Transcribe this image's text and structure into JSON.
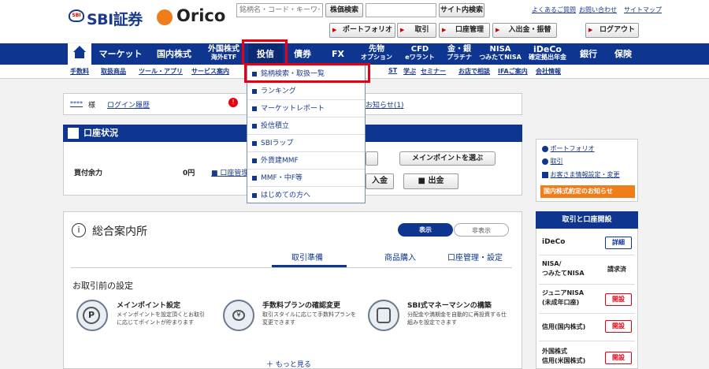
{
  "header": {
    "sbi_logo_text": "SBI証券",
    "sbi_mark_text": "SBI",
    "orico_logo_text": "Orico",
    "search_placeholder": "銘柄名・コード・キーワード",
    "stock_search_button": "株価検索",
    "site_search_button": "サイト内検索",
    "top_links": [
      "よくあるご質問",
      "お問い合わせ",
      "サイトマップ"
    ],
    "nav_buttons": [
      "ポートフォリオ",
      "取引",
      "口座管理",
      "入出金・振替"
    ],
    "logout_button": "ログアウト"
  },
  "main_nav": {
    "items": [
      {
        "label": "マーケット"
      },
      {
        "label": "国内株式"
      },
      {
        "label": "外国株式",
        "sub": "海外ETF"
      },
      {
        "label": "投信"
      },
      {
        "label": "債券"
      },
      {
        "label": "FX"
      },
      {
        "label": "先物",
        "sub": "オプション"
      },
      {
        "label": "CFD",
        "sub": "eワラント"
      },
      {
        "label": "金・銀",
        "sub": "プラチナ"
      },
      {
        "label": "NISA",
        "sub": "つみたてNISA"
      },
      {
        "label": "iDeCo",
        "sub": "確定拠出年金"
      },
      {
        "label": "銀行"
      },
      {
        "label": "保険"
      }
    ]
  },
  "sub_nav": [
    "手数料",
    "取扱商品",
    "ツール・アプリ",
    "サービス案内",
    "ST",
    "学ぶ",
    "セミナー",
    "お店で相談",
    "IFAご案内",
    "会社情報"
  ],
  "dropdown": {
    "items": [
      "銘柄検索・取扱一覧",
      "ランキング",
      "マーケットレポート",
      "投信積立",
      "SBIラップ",
      "外貨建MMF",
      "MMF・中F等",
      "はじめての方へ"
    ]
  },
  "user_bar": {
    "user_name": "****",
    "honorific": "様",
    "last_login_link": "ログイン履歴",
    "notice_link": "お知らせ(1)"
  },
  "account_status": {
    "title": "口座状況",
    "buying_power_label": "買付余力",
    "buying_power_value": "0円",
    "account_mgmt_link": "口座管理",
    "main_point_button": "メインポイントを選ぶ",
    "deposit_button": "入金",
    "withdraw_button": "出金"
  },
  "guide": {
    "title": "総合案内所",
    "toggle_show": "表示",
    "toggle_hide": "非表示",
    "tabs": [
      "取引準備",
      "商品購入",
      "口座管理・設定"
    ],
    "section_title": "お取引前の設定",
    "cards": [
      {
        "title": "メインポイント設定",
        "desc": "メインポイントを設定頂くとお取引に応じてポイントが貯まります"
      },
      {
        "title": "手数料プランの確認変更",
        "desc": "取引スタイルに応じて手数料プランを変更できます"
      },
      {
        "title": "SBI式マネーマシンの構築",
        "desc": "分配金や満期金を自動的に再投資する仕組みを設定できます"
      }
    ],
    "more_link": "もっと見る"
  },
  "right_panel": {
    "links": [
      "ポートフォリオ",
      "取引",
      "お客さま情報設定・変更"
    ],
    "orange_banner": "国内株式約定のお知らせ",
    "account_section_title": "取引と口座開設",
    "rows": [
      {
        "label": "iDeCo",
        "action": "詳細",
        "kind": "blue"
      },
      {
        "label": "NISA/\nつみたてNISA",
        "action": "請求済",
        "kind": "text"
      },
      {
        "label": "ジュニアNISA\n(未成年口座)",
        "action": "開設",
        "kind": "red"
      },
      {
        "label": "信用(国内株式)",
        "action": "開設",
        "kind": "red"
      },
      {
        "label": "外国株式\n信用(米国株式)",
        "action": "開設",
        "kind": "red"
      }
    ]
  },
  "colors": {
    "nav_blue": "#0e3691",
    "highlight_red": "#e60012",
    "orico_orange": "#ee7d1a"
  }
}
